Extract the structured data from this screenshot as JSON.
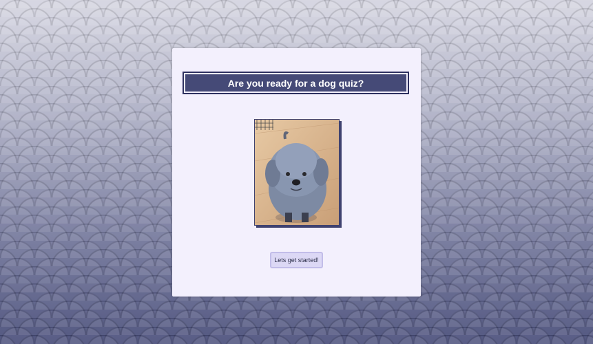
{
  "quiz": {
    "title": "Are you ready for a dog quiz?",
    "start_label": "Lets get started!"
  },
  "colors": {
    "accent": "#454a77",
    "card_background": "#f3f0fd",
    "button_background": "#dcd8f5"
  }
}
